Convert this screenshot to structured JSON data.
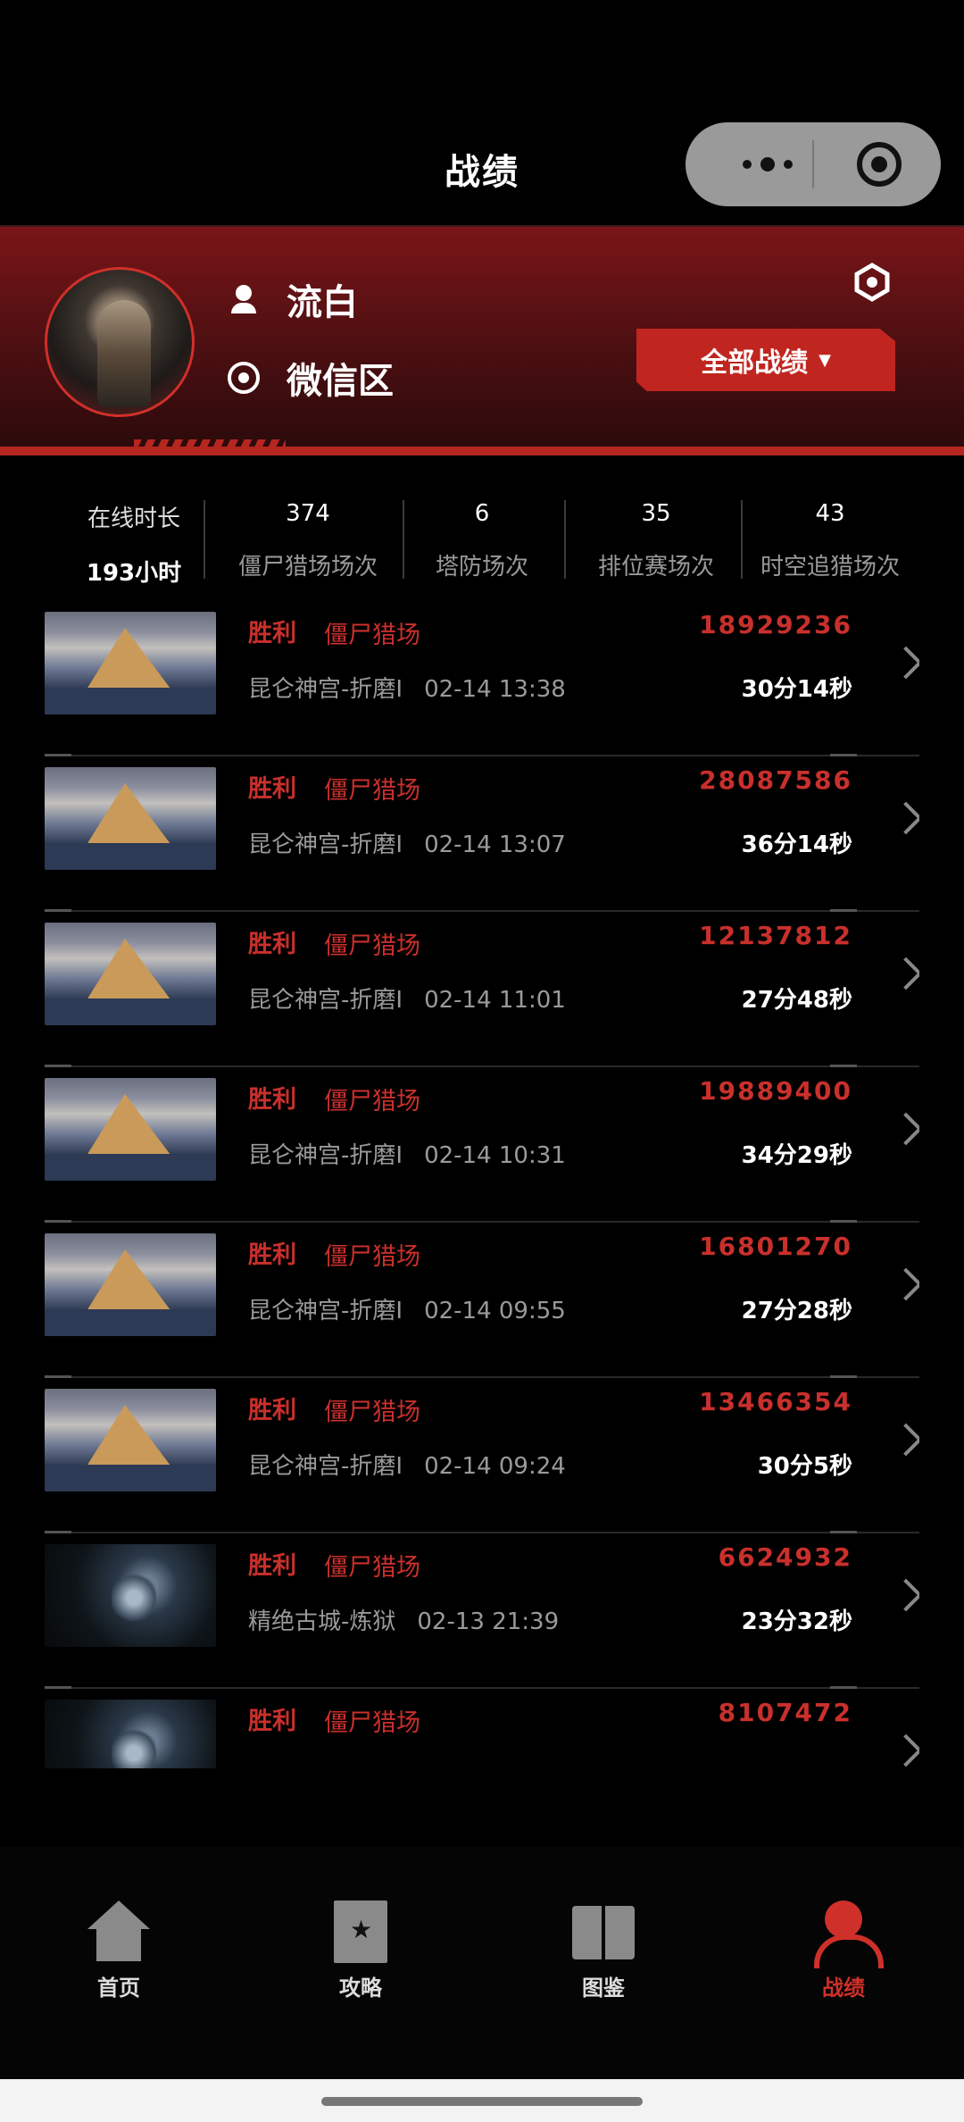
{
  "header": {
    "title": "战绩"
  },
  "profile": {
    "name": "流白",
    "zone": "微信区",
    "filter_label": "全部战绩",
    "filter_caret": "▼"
  },
  "stats": {
    "online_label": "在线时长",
    "online_value": "193小时",
    "items": [
      {
        "value": "374",
        "label": "僵尸猎场场次"
      },
      {
        "value": "6",
        "label": "塔防场次"
      },
      {
        "value": "35",
        "label": "排位赛场次"
      },
      {
        "value": "43",
        "label": "时空追猎场次"
      }
    ]
  },
  "records": [
    {
      "result": "胜利",
      "mode": "僵尸猎场",
      "map": "昆仑神宫-折磨I",
      "time": "02-14 13:38",
      "score": "18929236",
      "duration": "30分14秒",
      "thumb": "mountain"
    },
    {
      "result": "胜利",
      "mode": "僵尸猎场",
      "map": "昆仑神宫-折磨I",
      "time": "02-14 13:07",
      "score": "28087586",
      "duration": "36分14秒",
      "thumb": "mountain"
    },
    {
      "result": "胜利",
      "mode": "僵尸猎场",
      "map": "昆仑神宫-折磨I",
      "time": "02-14 11:01",
      "score": "12137812",
      "duration": "27分48秒",
      "thumb": "mountain"
    },
    {
      "result": "胜利",
      "mode": "僵尸猎场",
      "map": "昆仑神宫-折磨I",
      "time": "02-14 10:31",
      "score": "19889400",
      "duration": "34分29秒",
      "thumb": "mountain"
    },
    {
      "result": "胜利",
      "mode": "僵尸猎场",
      "map": "昆仑神宫-折磨I",
      "time": "02-14 09:55",
      "score": "16801270",
      "duration": "27分28秒",
      "thumb": "mountain"
    },
    {
      "result": "胜利",
      "mode": "僵尸猎场",
      "map": "昆仑神宫-折磨I",
      "time": "02-14 09:24",
      "score": "13466354",
      "duration": "30分5秒",
      "thumb": "mountain"
    },
    {
      "result": "胜利",
      "mode": "僵尸猎场",
      "map": "精绝古城-炼狱",
      "time": "02-13 21:39",
      "score": "6624932",
      "duration": "23分32秒",
      "thumb": "dark"
    },
    {
      "result": "胜利",
      "mode": "僵尸猎场",
      "map": "",
      "time": "",
      "score": "8107472",
      "duration": "",
      "thumb": "dark"
    }
  ],
  "tabs": [
    {
      "label": "首页",
      "icon": "home-icon",
      "active": false
    },
    {
      "label": "攻略",
      "icon": "guide-book-icon",
      "active": false
    },
    {
      "label": "图鉴",
      "icon": "open-book-icon",
      "active": false
    },
    {
      "label": "战绩",
      "icon": "profile-icon",
      "active": true
    }
  ],
  "colors": {
    "accent": "#c9302c",
    "header_gradient_top": "#7a1518",
    "background": "#000000"
  }
}
